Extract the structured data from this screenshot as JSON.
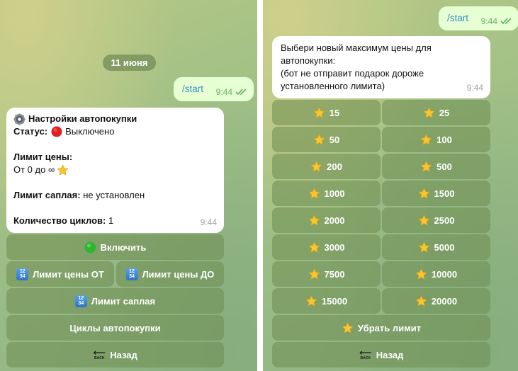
{
  "left_chat": {
    "date_label": "11 июня",
    "outgoing": {
      "text": "/start",
      "time": "9:44"
    },
    "settings_message": {
      "title": "Настройки автопокупки",
      "status_label": "Статус:",
      "status_value": "Выключено",
      "price_limit_label": "Лимит цены:",
      "price_limit_value": "От 0 до ∞",
      "supply_limit_label": "Лимит саплая:",
      "supply_limit_value": "не установлен",
      "cycles_label": "Количество циклов:",
      "cycles_value": "1",
      "time": "9:44"
    },
    "keyboard": {
      "enable": "Включить",
      "price_from": "Лимит цены ОТ",
      "price_to": "Лимит цены ДО",
      "supply_limit": "Лимит саплая",
      "cycles": "Циклы автопокупки",
      "back": "Назад"
    }
  },
  "right_chat": {
    "outgoing": {
      "text": "/start",
      "time": "9:44"
    },
    "prompt_message": {
      "lines": [
        "Выбери новый максимум цены для",
        "автопокупки:",
        "(бот не отправит подарок дороже",
        "установленного лимита)"
      ],
      "time": "9:44"
    },
    "price_options": [
      "15",
      "25",
      "50",
      "100",
      "200",
      "500",
      "1000",
      "1500",
      "2000",
      "2500",
      "3000",
      "5000",
      "7500",
      "10000",
      "15000",
      "20000"
    ],
    "remove_limit": "Убрать лимит",
    "back": "Назад"
  },
  "icons": {
    "gear": "gear-icon",
    "status": "red-circle-icon",
    "star": "star-icon",
    "enable": "green-circle-icon",
    "keycap": "input-numbers-icon",
    "back": "back-arrow-icon"
  },
  "colors": {
    "incoming_bubble": "#ffffff",
    "outgoing_bubble": "#e6ffd3",
    "button_bg": "rgba(110,140,80,0.55)",
    "star": "#f7c631",
    "status_red": "#e02020",
    "enable_green": "#2fb52f"
  }
}
